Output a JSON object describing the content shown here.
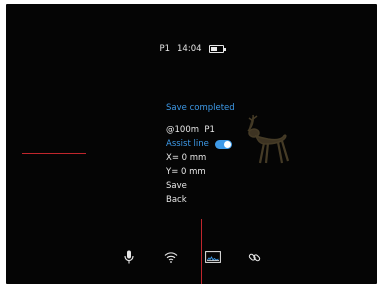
{
  "status_bar": {
    "profile": "P1",
    "time": "14:04",
    "battery_level": 0.6
  },
  "menu": {
    "status_message": "Save completed",
    "distance_profile": "@100m  P1",
    "assist_line_label": "Assist line",
    "assist_line_enabled": true,
    "x_offset": "X= 0 mm",
    "y_offset": "Y= 0 mm",
    "save_label": "Save",
    "back_label": "Back"
  },
  "bottom_icons": [
    "microphone-icon",
    "wifi-icon",
    "recording-icon",
    "link-icon"
  ],
  "colors": {
    "accent": "#3e9ae8",
    "reticle": "#c0262c",
    "text": "#e8e8e8",
    "background": "#050505"
  }
}
